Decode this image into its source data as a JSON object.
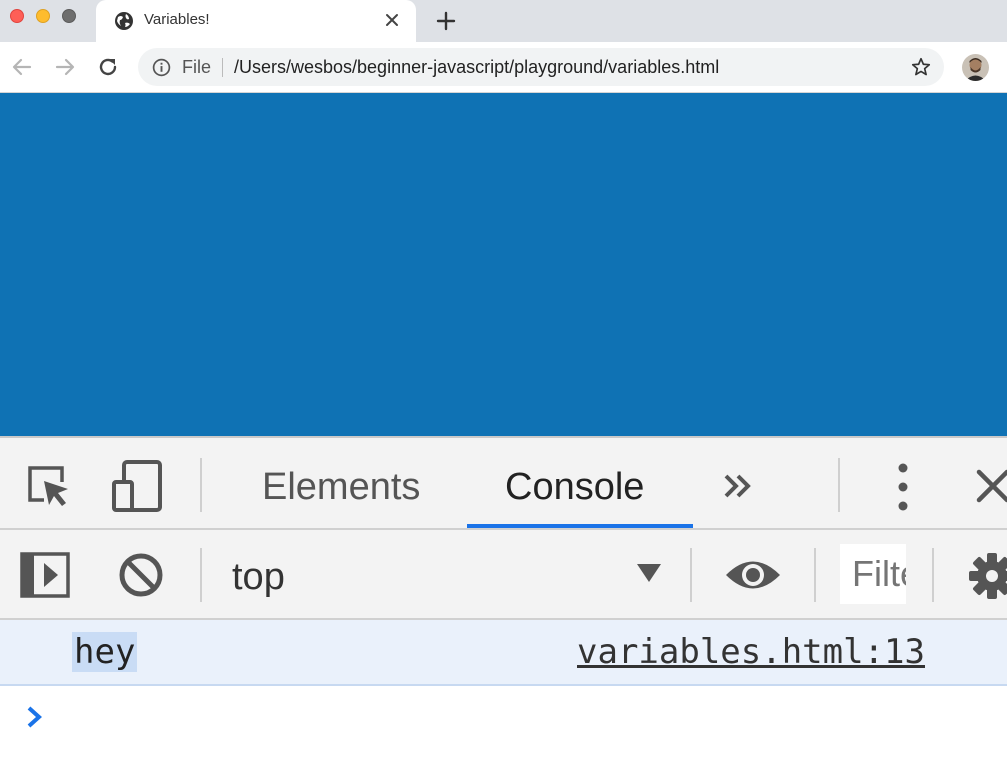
{
  "browser": {
    "tab": {
      "title": "Variables!"
    },
    "address": {
      "scheme_label": "File",
      "url": "/Users/wesbos/beginner-javascript/playground/variables.html"
    }
  },
  "page": {
    "background_color": "#0f72b4"
  },
  "devtools": {
    "tabs": [
      {
        "label": "Elements",
        "active": false
      },
      {
        "label": "Console",
        "active": true
      }
    ],
    "more_tabs_icon": "double-chevron-right-icon",
    "console": {
      "context": "top",
      "filter_placeholder": "Filter",
      "messages": [
        {
          "text": "hey",
          "source": "variables.html:13"
        }
      ]
    }
  },
  "colors": {
    "accent": "#1a73e8",
    "traffic_close": "#fe5f57",
    "traffic_min": "#febc2e"
  }
}
